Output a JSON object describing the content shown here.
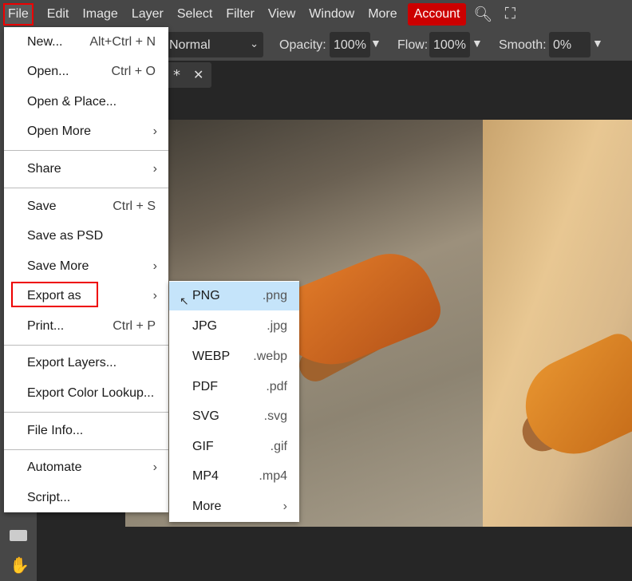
{
  "menubar": {
    "items": [
      "File",
      "Edit",
      "Image",
      "Layer",
      "Select",
      "Filter",
      "View",
      "Window",
      "More"
    ],
    "account": "Account"
  },
  "toolbar": {
    "blend_mode": "Normal",
    "opacity_label": "Opacity:",
    "opacity": "100%",
    "flow_label": "Flow:",
    "flow": "100%",
    "smooth_label": "Smooth:",
    "smooth": "0%"
  },
  "tab": {
    "modified": "*",
    "close": "✕"
  },
  "file_menu": {
    "items": [
      {
        "label": "New...",
        "shortcut": "Alt+Ctrl + N"
      },
      {
        "label": "Open...",
        "shortcut": "Ctrl + O"
      },
      {
        "label": "Open & Place..."
      },
      {
        "label": "Open More",
        "submenu": true
      },
      {
        "label": "Share",
        "submenu": true
      },
      {
        "label": "Save",
        "shortcut": "Ctrl + S"
      },
      {
        "label": "Save as PSD"
      },
      {
        "label": "Save More",
        "submenu": true
      },
      {
        "label": "Export as",
        "submenu": true
      },
      {
        "label": "Print...",
        "shortcut": "Ctrl + P"
      },
      {
        "label": "Export Layers..."
      },
      {
        "label": "Export Color Lookup..."
      },
      {
        "label": "File Info..."
      },
      {
        "label": "Automate",
        "submenu": true
      },
      {
        "label": "Script..."
      }
    ]
  },
  "export_submenu": {
    "items": [
      {
        "label": "PNG",
        "ext": ".png"
      },
      {
        "label": "JPG",
        "ext": ".jpg"
      },
      {
        "label": "WEBP",
        "ext": ".webp"
      },
      {
        "label": "PDF",
        "ext": ".pdf"
      },
      {
        "label": "SVG",
        "ext": ".svg"
      },
      {
        "label": "GIF",
        "ext": ".gif"
      },
      {
        "label": "MP4",
        "ext": ".mp4"
      },
      {
        "label": "More",
        "ext": "›"
      }
    ]
  },
  "colors": {
    "accent": "#cc0000",
    "highlight": "#c5e4fa"
  }
}
